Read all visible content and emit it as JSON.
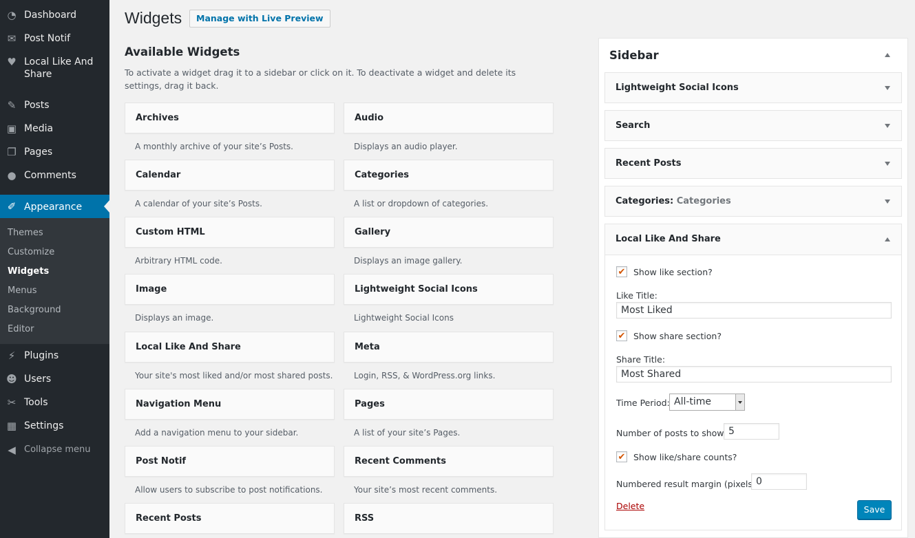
{
  "admin_menu": {
    "items": [
      {
        "label": "Dashboard",
        "icon": "dashboard-icon"
      },
      {
        "label": "Post Notif",
        "icon": "envelope-icon"
      },
      {
        "label": "Local Like And Share",
        "icon": "heart-icon"
      },
      {
        "label": "Posts",
        "icon": "pushpin-icon"
      },
      {
        "label": "Media",
        "icon": "media-icon"
      },
      {
        "label": "Pages",
        "icon": "pages-icon"
      },
      {
        "label": "Comments",
        "icon": "comment-icon"
      },
      {
        "label": "Appearance",
        "icon": "paintbrush-icon"
      },
      {
        "label": "Plugins",
        "icon": "plugin-icon"
      },
      {
        "label": "Users",
        "icon": "user-icon"
      },
      {
        "label": "Tools",
        "icon": "wrench-icon"
      },
      {
        "label": "Settings",
        "icon": "settings-icon"
      },
      {
        "label": "Collapse menu",
        "icon": "collapse-icon"
      }
    ],
    "submenu": [
      "Themes",
      "Customize",
      "Widgets",
      "Menus",
      "Background",
      "Editor"
    ]
  },
  "header": {
    "title": "Widgets",
    "live_preview_label": "Manage with Live Preview"
  },
  "available": {
    "title": "Available Widgets",
    "description": "To activate a widget drag it to a sidebar or click on it. To deactivate a widget and delete its settings, drag it back.",
    "widgets": [
      {
        "name": "Archives",
        "desc": "A monthly archive of your site’s Posts."
      },
      {
        "name": "Audio",
        "desc": "Displays an audio player."
      },
      {
        "name": "Calendar",
        "desc": "A calendar of your site’s Posts."
      },
      {
        "name": "Categories",
        "desc": "A list or dropdown of categories."
      },
      {
        "name": "Custom HTML",
        "desc": "Arbitrary HTML code."
      },
      {
        "name": "Gallery",
        "desc": "Displays an image gallery."
      },
      {
        "name": "Image",
        "desc": "Displays an image."
      },
      {
        "name": "Lightweight Social Icons",
        "desc": "Lightweight Social Icons"
      },
      {
        "name": "Local Like And Share",
        "desc": "Your site's most liked and/or most shared posts."
      },
      {
        "name": "Meta",
        "desc": "Login, RSS, & WordPress.org links."
      },
      {
        "name": "Navigation Menu",
        "desc": "Add a navigation menu to your sidebar."
      },
      {
        "name": "Pages",
        "desc": "A list of your site’s Pages."
      },
      {
        "name": "Post Notif",
        "desc": "Allow users to subscribe to post notifications."
      },
      {
        "name": "Recent Comments",
        "desc": "Your site’s most recent comments."
      },
      {
        "name": "Recent Posts",
        "desc": ""
      },
      {
        "name": "RSS",
        "desc": ""
      }
    ]
  },
  "sidebar": {
    "title": "Sidebar",
    "widgets": [
      {
        "name": "Lightweight Social Icons",
        "instance": ""
      },
      {
        "name": "Search",
        "instance": ""
      },
      {
        "name": "Recent Posts",
        "instance": ""
      },
      {
        "name": "Categories:",
        "instance": "Categories"
      }
    ],
    "open_widget": {
      "name": "Local Like And Share",
      "show_like_label": "Show like section?",
      "show_like_checked": true,
      "like_title_label": "Like Title:",
      "like_title_value": "Most Liked",
      "show_share_label": "Show share section?",
      "show_share_checked": true,
      "share_title_label": "Share Title:",
      "share_title_value": "Most Shared",
      "time_period_label": "Time Period:",
      "time_period_value": "All-time",
      "num_posts_label": "Number of posts to show:",
      "num_posts_value": "5",
      "show_counts_label": "Show like/share counts?",
      "show_counts_checked": true,
      "margin_label": "Numbered result margin (pixels):",
      "margin_value": "0",
      "delete_label": "Delete",
      "save_label": "Save"
    }
  },
  "colors": {
    "menu_bg": "#23282d",
    "accent": "#0073aa",
    "save_button": "#0085ba",
    "checkmark": "#d35400",
    "delete_link": "#aa0000"
  }
}
